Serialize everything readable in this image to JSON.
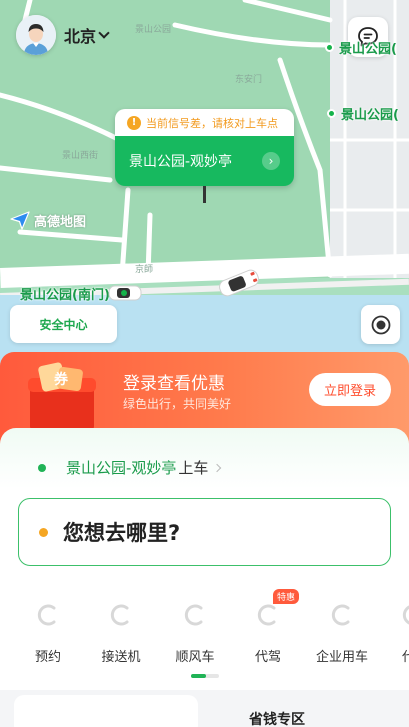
{
  "header": {
    "city": "北京",
    "avatar_icon": "user-avatar-icon",
    "message_icon": "chat-bubble-icon"
  },
  "map": {
    "provider_logo": "高德地图",
    "poi_top_right": "景山公园(",
    "poi_right": "景山公园(",
    "poi_south_gate": "景山公园(南门)",
    "labels": [
      "景山公园",
      "景山西街",
      "东安门",
      "京師",
      "高德地图"
    ],
    "pickup": {
      "warning": "当前信号差，请核对上车点",
      "place": "景山公园-观妙亭"
    },
    "safety_center": "安全中心",
    "colors": {
      "accent": "#17b95f",
      "warning": "#f29a1e"
    }
  },
  "promo": {
    "title": "登录查看优惠",
    "subtitle": "绿色出行，共同美好",
    "login_button": "立即登录",
    "gift_text": "券"
  },
  "booking": {
    "from_place": "景山公园-观妙亭",
    "from_suffix": "上车",
    "destination_placeholder": "您想去哪里?"
  },
  "services": {
    "items": [
      {
        "label": "预约",
        "badge": ""
      },
      {
        "label": "接送机",
        "badge": ""
      },
      {
        "label": "顺风车",
        "badge": ""
      },
      {
        "label": "代驾",
        "badge": "特惠"
      },
      {
        "label": "企业用车",
        "badge": ""
      },
      {
        "label": "代",
        "badge": ""
      }
    ]
  },
  "bottom": {
    "saving_title": "省钱专区"
  }
}
